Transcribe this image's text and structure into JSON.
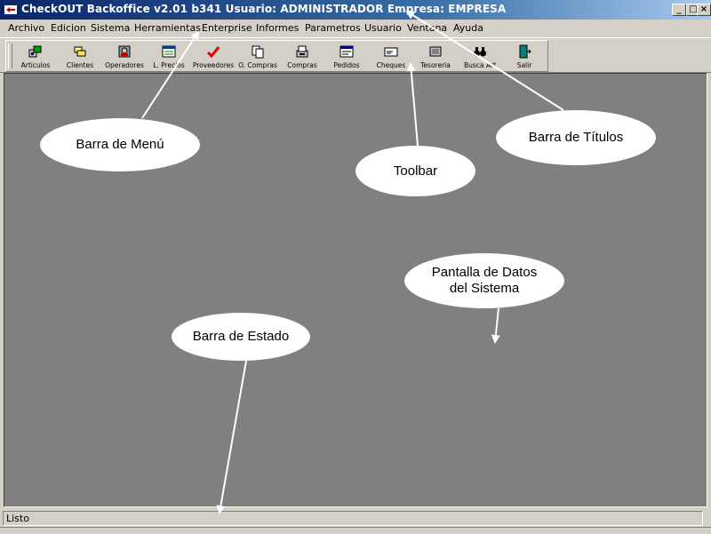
{
  "window": {
    "title": "CheckOUT Backoffice v2.01 b341 Usuario: ADMINISTRADOR Empresa: EMPRESA",
    "minimize_glyph": "_",
    "maximize_glyph": "□",
    "close_glyph": "×"
  },
  "menu": [
    {
      "label": "Archivo"
    },
    {
      "label": "Edicion"
    },
    {
      "label": "Sistema"
    },
    {
      "label": "Herramientas"
    },
    {
      "label": "Enterprise"
    },
    {
      "label": "Informes"
    },
    {
      "label": "Parametros"
    },
    {
      "label": "Usuario"
    },
    {
      "label": "Ventana"
    },
    {
      "label": "Ayuda"
    }
  ],
  "toolbar": [
    {
      "label": "Articulos",
      "icon": "articles-icon"
    },
    {
      "label": "Clientes",
      "icon": "clients-icon"
    },
    {
      "label": "Operadores",
      "icon": "operators-icon"
    },
    {
      "label": "L. Precios",
      "icon": "price-list-icon"
    },
    {
      "label": "Proveedores",
      "icon": "suppliers-icon"
    },
    {
      "label": "O. Compras",
      "icon": "purchase-orders-icon"
    },
    {
      "label": "Compras",
      "icon": "purchases-icon"
    },
    {
      "label": "Pedidos",
      "icon": "orders-icon"
    },
    {
      "label": "Cheques",
      "icon": "checks-icon"
    },
    {
      "label": "Tesoreria",
      "icon": "treasury-icon"
    },
    {
      "label": "Busca Art",
      "icon": "binoculars-icon"
    },
    {
      "label": "Salir",
      "icon": "exit-icon"
    }
  ],
  "status": {
    "text": "Listo"
  },
  "callouts": {
    "menu_bar": "Barra de Menú",
    "toolbar": "Toolbar",
    "title_bar": "Barra de Títulos",
    "data_screen_line1": "Pantalla de Datos",
    "data_screen_line2": "del Sistema",
    "status_bar": "Barra de Estado"
  },
  "colors": {
    "title_start": "#0a246a",
    "title_end": "#a6caf0",
    "workspace": "#808080",
    "chrome": "#d4d0c8"
  }
}
